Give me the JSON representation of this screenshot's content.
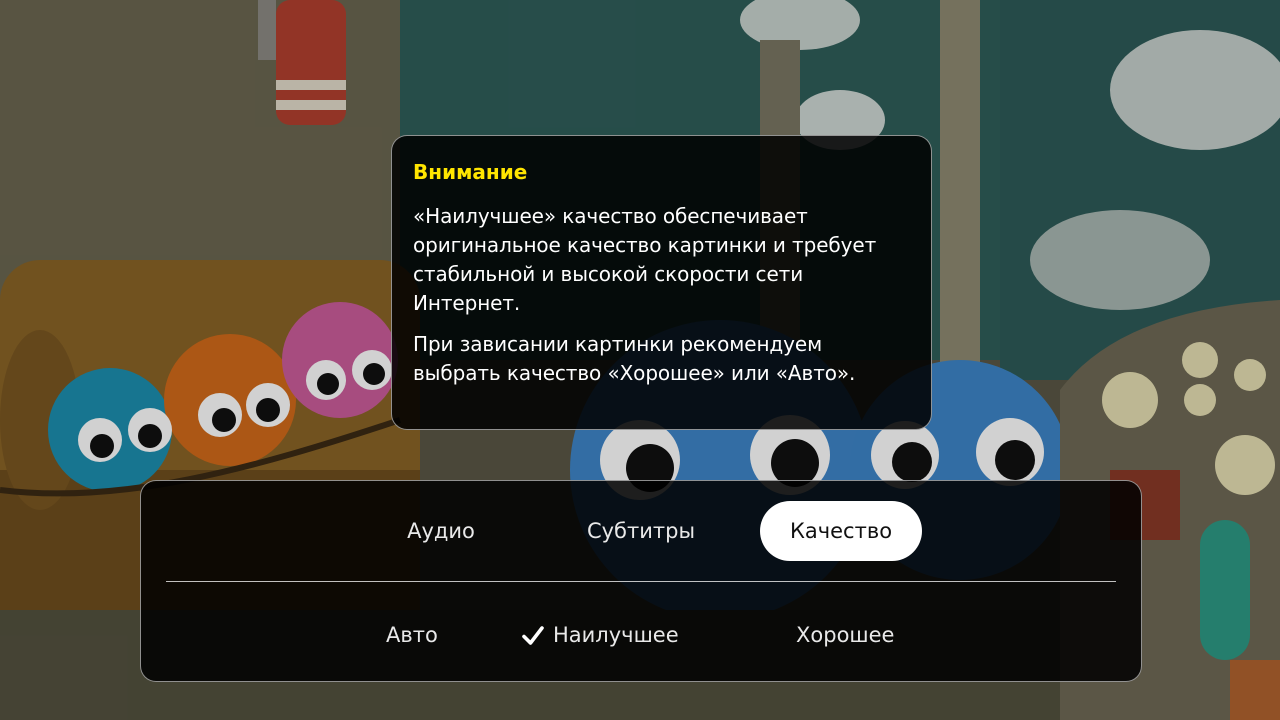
{
  "warning": {
    "title": "Внимание",
    "paragraph_1": "«Наилучшее» качество обеспечивает оригинальное качество картинки и требует стабильной и высокой скорости сети Интернет.",
    "paragraph_2": "При зависании картинки рекомендуем выбрать качество «Хорошее» или «Авто».",
    "title_color": "#ffe500"
  },
  "tabs": [
    {
      "label": "Аудио",
      "selected": false
    },
    {
      "label": "Субтитры",
      "selected": false
    },
    {
      "label": "Качество",
      "selected": true
    }
  ],
  "quality_options": [
    {
      "label": "Авто",
      "checked": false
    },
    {
      "label": "Наилучшее",
      "checked": true,
      "icon": "checkmark-icon"
    },
    {
      "label": "Хорошее",
      "checked": false
    }
  ]
}
